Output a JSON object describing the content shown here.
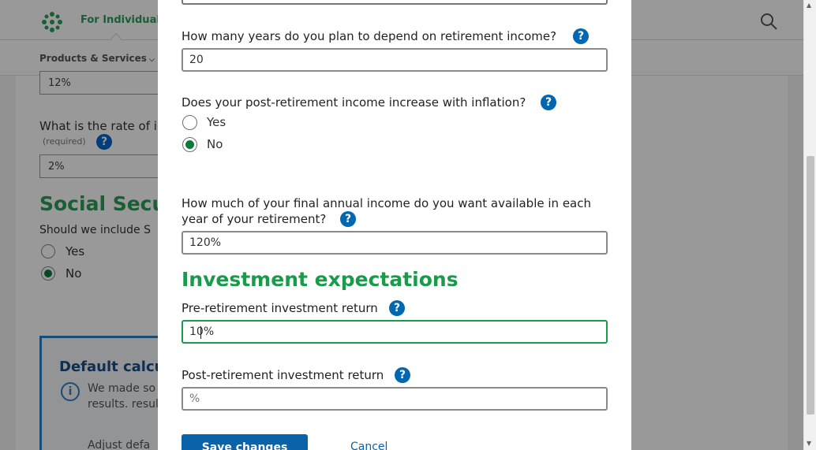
{
  "header": {
    "nav_individuals": "For Individuals",
    "logo_icon": "brand-logo-icon",
    "search_icon": "search-icon"
  },
  "subnav": {
    "products_label": "Products & Services"
  },
  "background_form": {
    "input_top_value": "12%",
    "rate_label": "What is the rate of i",
    "rate_required": "(required)",
    "rate_value": "2%",
    "social_title": "Social Secur",
    "social_question": "Should we include S",
    "yes_label": "Yes",
    "no_label": "No",
    "default_box_title": "Default calcu",
    "default_box_text": "We made so your results. results.",
    "default_box_text_2": "Adjust defa"
  },
  "modal": {
    "years_question": "How many years do you plan to depend on retirement income?",
    "years_value": "20",
    "inflation_question": "Does your post-retirement income increase with inflation?",
    "inflation_options": [
      "Yes",
      "No"
    ],
    "inflation_selected": "No",
    "income_question_line1": "How much of your final annual income do you want available in each",
    "income_question_line2": "year of your retirement?",
    "income_value": "120%",
    "investment_title": "Investment expectations",
    "pre_return_label": "Pre-retirement investment return",
    "pre_return_value": "10%",
    "post_return_label": "Post-retirement investment return",
    "post_return_placeholder": "%",
    "save_label": "Save changes",
    "cancel_label": "Cancel",
    "help_icon_glyph": "?"
  },
  "colors": {
    "brand_green": "#1a9a4a",
    "help_blue": "#0067b1",
    "button_blue": "#0a62a8",
    "radio_checked": "#0b7a3e"
  }
}
